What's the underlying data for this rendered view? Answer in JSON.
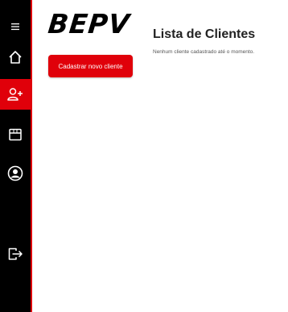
{
  "brand": {
    "logo_text": "BEPV",
    "accent_color": "#e0000a",
    "sidebar_color": "#000000"
  },
  "sidebar": {
    "items": [
      {
        "icon": "menu-icon",
        "active": false
      },
      {
        "icon": "home-icon",
        "active": false
      },
      {
        "icon": "add-user-icon",
        "active": true
      },
      {
        "icon": "box-icon",
        "active": false
      },
      {
        "icon": "user-circle-icon",
        "active": false
      },
      {
        "icon": "logout-icon",
        "active": false
      }
    ]
  },
  "main": {
    "add_button_label": "Cadastrar novo cliente",
    "title": "Lista de Clientes",
    "empty_message": "Nenhum cliente cadastrado até o momento."
  }
}
